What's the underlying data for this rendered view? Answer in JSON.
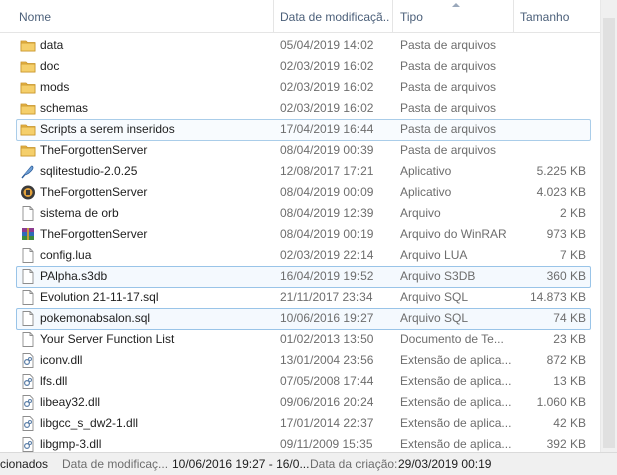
{
  "columns": {
    "name": "Nome",
    "date": "Data de modificaçã...",
    "type": "Tipo",
    "size": "Tamanho"
  },
  "files": [
    {
      "name": "data",
      "date": "05/04/2019 14:02",
      "type": "Pasta de arquivos",
      "size": "",
      "icon": "folder-icon"
    },
    {
      "name": "doc",
      "date": "02/03/2019 16:02",
      "type": "Pasta de arquivos",
      "size": "",
      "icon": "folder-icon"
    },
    {
      "name": "mods",
      "date": "02/03/2019 16:02",
      "type": "Pasta de arquivos",
      "size": "",
      "icon": "folder-icon"
    },
    {
      "name": "schemas",
      "date": "02/03/2019 16:02",
      "type": "Pasta de arquivos",
      "size": "",
      "icon": "folder-icon"
    },
    {
      "name": "Scripts a serem inseridos",
      "date": "17/04/2019 16:44",
      "type": "Pasta de arquivos",
      "size": "",
      "icon": "folder-icon",
      "state": "sel-light"
    },
    {
      "name": "TheForgottenServer",
      "date": "08/04/2019 00:39",
      "type": "Pasta de arquivos",
      "size": "",
      "icon": "folder-icon"
    },
    {
      "name": "sqlitestudio-2.0.25",
      "date": "12/08/2017 17:21",
      "type": "Aplicativo",
      "size": "5.225 KB",
      "icon": "feather-icon"
    },
    {
      "name": "TheForgottenServer",
      "date": "08/04/2019 00:09",
      "type": "Aplicativo",
      "size": "4.023 KB",
      "icon": "app-icon"
    },
    {
      "name": "sistema de orb",
      "date": "08/04/2019 12:39",
      "type": "Arquivo",
      "size": "2 KB",
      "icon": "file-icon"
    },
    {
      "name": "TheForgottenServer",
      "date": "08/04/2019 00:19",
      "type": "Arquivo do WinRAR",
      "size": "973 KB",
      "icon": "winrar-icon"
    },
    {
      "name": "config.lua",
      "date": "02/03/2019 22:14",
      "type": "Arquivo LUA",
      "size": "7 KB",
      "icon": "file-icon"
    },
    {
      "name": "PAlpha.s3db",
      "date": "16/04/2019 19:52",
      "type": "Arquivo S3DB",
      "size": "360 KB",
      "icon": "file-icon",
      "state": "selected"
    },
    {
      "name": "Evolution 21-11-17.sql",
      "date": "21/11/2017 23:34",
      "type": "Arquivo SQL",
      "size": "14.873 KB",
      "icon": "file-icon"
    },
    {
      "name": "pokemonabsalon.sql",
      "date": "10/06/2016 19:27",
      "type": "Arquivo SQL",
      "size": "74 KB",
      "icon": "file-icon",
      "state": "selected"
    },
    {
      "name": "Your Server Function List",
      "date": "01/02/2013 13:50",
      "type": "Documento de Te...",
      "size": "23 KB",
      "icon": "file-icon"
    },
    {
      "name": "iconv.dll",
      "date": "13/01/2004 23:56",
      "type": "Extensão de aplica...",
      "size": "872 KB",
      "icon": "dll-icon"
    },
    {
      "name": "lfs.dll",
      "date": "07/05/2008 17:44",
      "type": "Extensão de aplica...",
      "size": "13 KB",
      "icon": "dll-icon"
    },
    {
      "name": "libeay32.dll",
      "date": "09/06/2016 20:24",
      "type": "Extensão de aplica...",
      "size": "1.060 KB",
      "icon": "dll-icon"
    },
    {
      "name": "libgcc_s_dw2-1.dll",
      "date": "17/01/2014 22:37",
      "type": "Extensão de aplica...",
      "size": "42 KB",
      "icon": "dll-icon"
    },
    {
      "name": "libgmp-3.dll",
      "date": "09/11/2009 15:35",
      "type": "Extensão de aplica...",
      "size": "392 KB",
      "icon": "dll-icon"
    }
  ],
  "status": {
    "selected_text": "cionados",
    "date_mod_label": "Data de modificaç...",
    "date_mod_value": "10/06/2016 19:27 - 16/0...",
    "created_label": "Data da criação:",
    "created_value": "29/03/2019 00:19"
  }
}
